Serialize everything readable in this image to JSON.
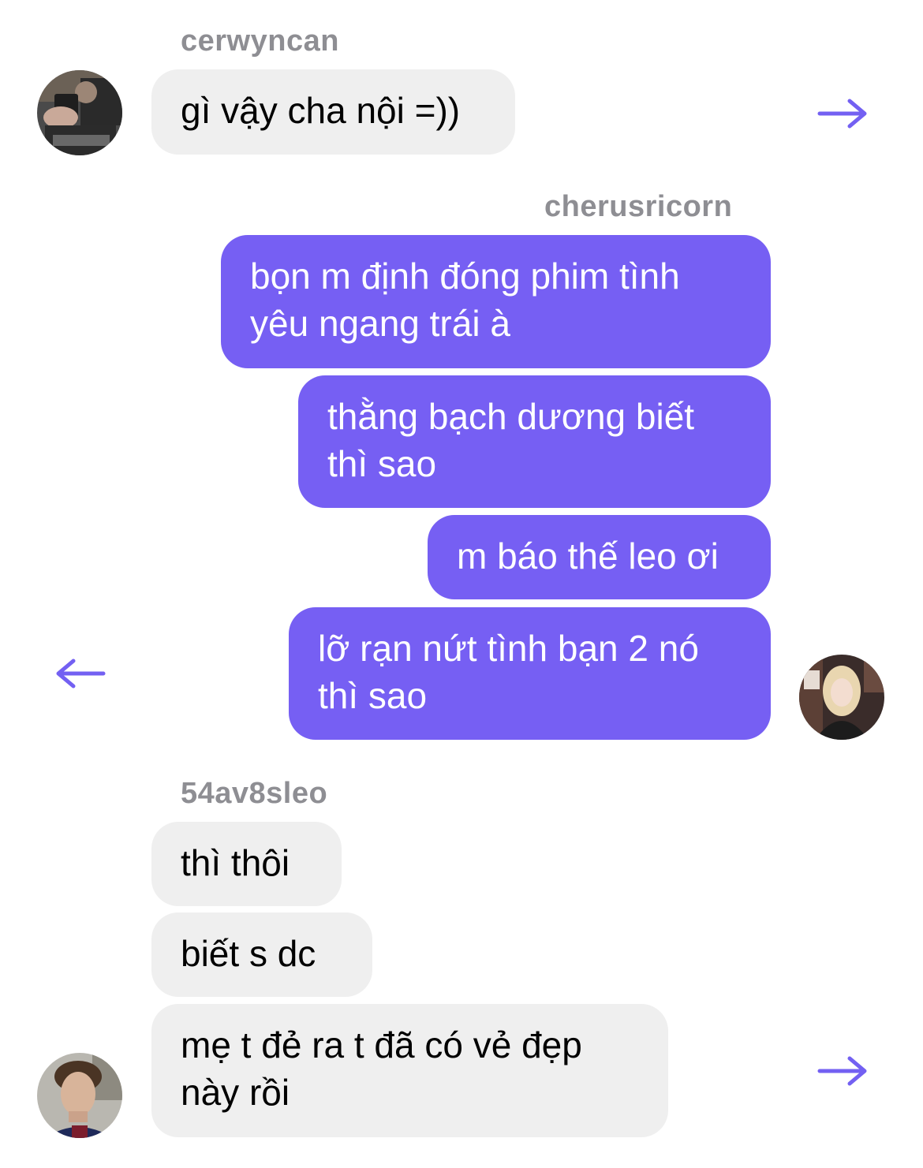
{
  "colors": {
    "outgoing_bubble": "#765ff3",
    "incoming_bubble": "#efefef",
    "username": "#8e8e93",
    "arrow": "#7360f2"
  },
  "group1": {
    "username": "cerwyncan",
    "avatar_icon": "avatar-photo-cerwyncan",
    "messages": [
      "gì vậy cha nội =))"
    ],
    "arrow_icon": "arrow-right-icon"
  },
  "group2": {
    "username": "cherusricorn",
    "avatar_icon": "avatar-photo-cherusricorn",
    "messages": [
      "bọn m định đóng phim tình\nyêu ngang trái à",
      "thằng bạch dương biết\nthì sao",
      "m báo thế leo ơi",
      "lỡ rạn nứt tình bạn 2 nó\nthì sao"
    ],
    "arrow_icon": "arrow-left-icon"
  },
  "group3": {
    "username": "54av8sleo",
    "avatar_icon": "avatar-photo-54av8sleo",
    "messages": [
      "thì thôi",
      "biết s dc",
      "mẹ t đẻ ra t đã có vẻ đẹp\nnày rồi"
    ],
    "arrow_icon": "arrow-right-icon"
  }
}
